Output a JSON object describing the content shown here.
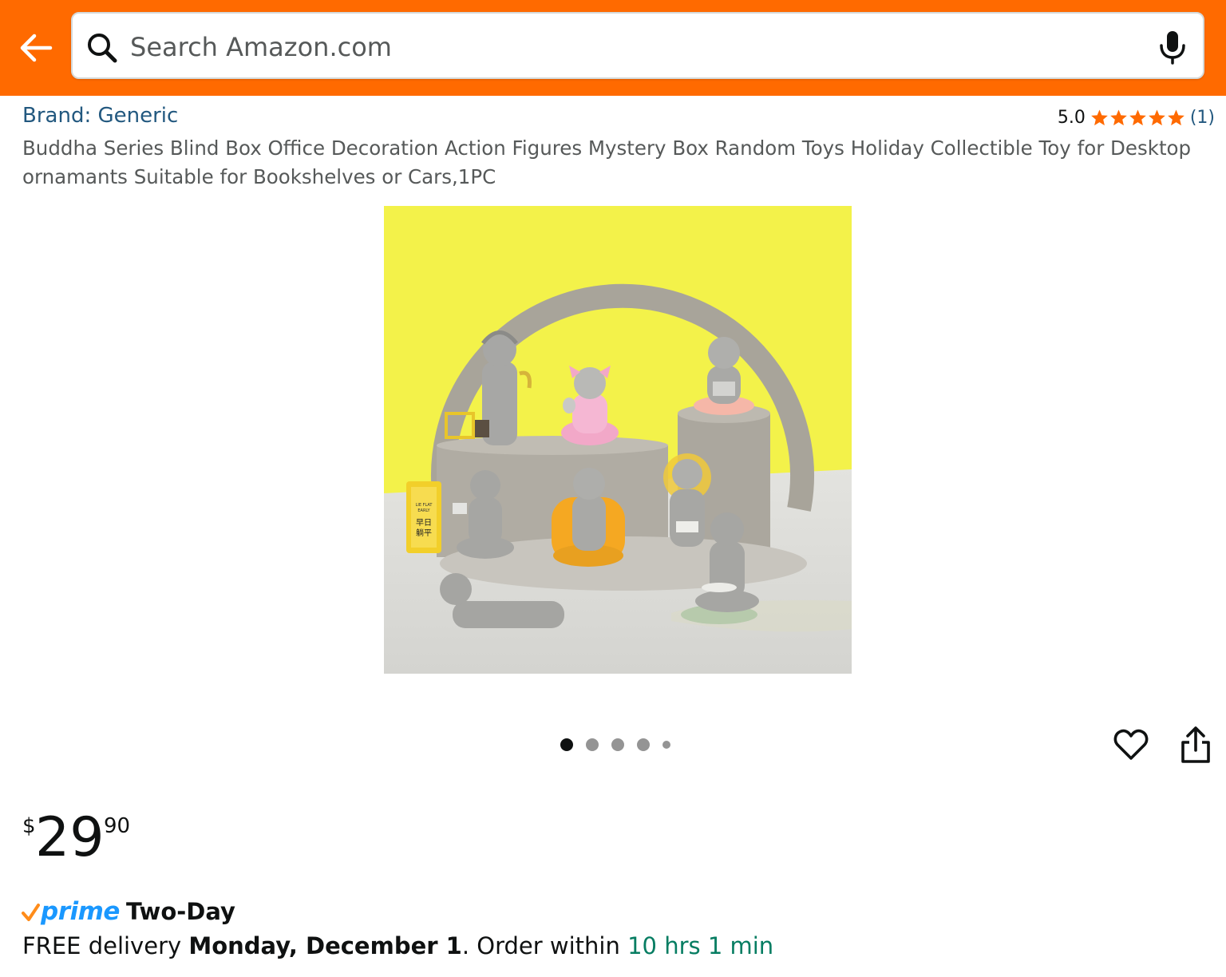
{
  "header": {
    "search_placeholder": "Search Amazon.com"
  },
  "product": {
    "brand": "Brand: Generic",
    "rating_value": "5.0",
    "stars": 5,
    "rating_count": "(1)",
    "title": "Buddha Series Blind Box Office Decoration Action Figures Mystery Box Random Toys Holiday Collectible Toy for Desktop ornamants Suitable for Bookshelves or Cars,1PC",
    "image_sign_text": "早日躺平",
    "image_sign_small": "LIE FLAT EARLY"
  },
  "carousel": {
    "total_images": 5,
    "active_index": 0
  },
  "price": {
    "symbol": "$",
    "whole": "29",
    "fraction": "90"
  },
  "prime": {
    "brand": "prime",
    "speed": "Two-Day"
  },
  "delivery": {
    "prefix": "FREE delivery ",
    "date": "Monday, December 1",
    "middle": ". Order within ",
    "countdown": "10 hrs 1 min"
  },
  "colors": {
    "header_bg": "#ff6a00",
    "link": "#22587f",
    "star": "#ff6a00",
    "prime_blue": "#1a98ff",
    "countdown_green": "#067d62"
  },
  "icons": [
    "back-arrow-icon",
    "search-icon",
    "microphone-icon",
    "star-icon",
    "heart-icon",
    "share-icon",
    "prime-check-icon"
  ]
}
